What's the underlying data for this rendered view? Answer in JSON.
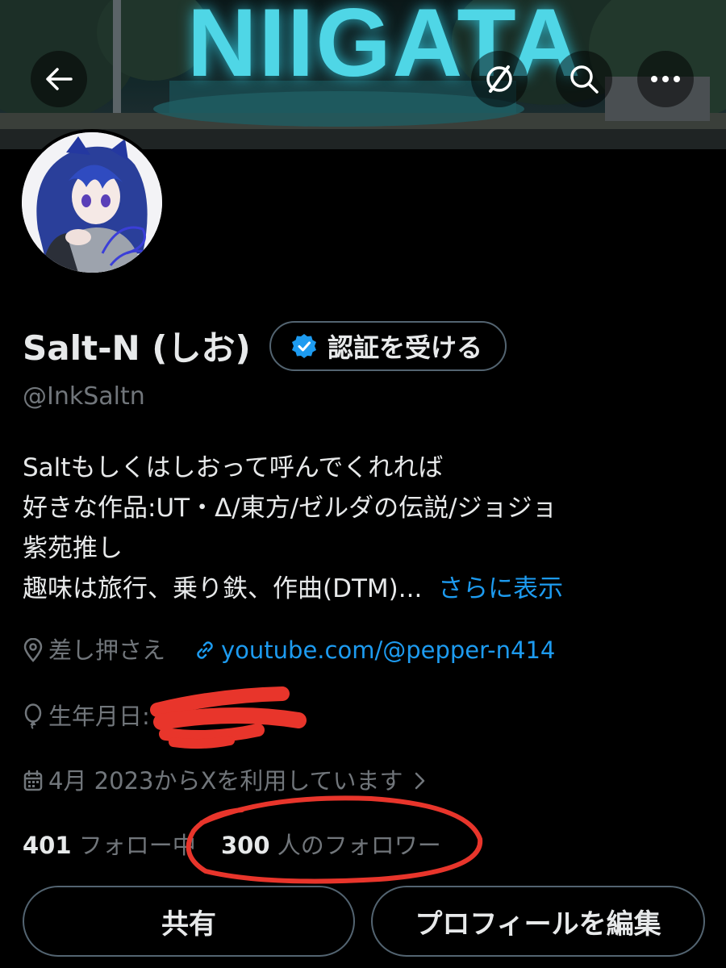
{
  "header": {
    "banner_sign_text": "NIIGATA",
    "back_icon": "arrow-left-icon",
    "grok_icon": "grok-slash-circle-icon",
    "search_icon": "search-icon",
    "more_icon": "more-horizontal-icon"
  },
  "profile": {
    "display_name": "Salt-N (しお)",
    "verify_button_label": "認証を受ける",
    "handle": "@InkSaltn",
    "bio_lines": [
      "Saltもしくはしおって呼んでくれれば",
      "好きな作品:UT・Δ/東方/ゼルダの伝説/ジョジョ",
      "紫苑推し",
      "趣味は旅行、乗り鉄、作曲(DTM)..."
    ],
    "show_more_label": "さらに表示",
    "location": "差し押さえ",
    "website": "youtube.com/@pepper-n414",
    "birthday_label": "生年月日:",
    "joined": "4月 2023からXを利用しています",
    "following_count": "401",
    "following_label": "フォロー中",
    "followers_count": "300",
    "followers_label": "人のフォロワー"
  },
  "actions": {
    "share_label": "共有",
    "edit_profile_label": "プロフィールを編集"
  },
  "colors": {
    "background": "#000000",
    "primary_text": "#e7e9ea",
    "secondary_text": "#71767b",
    "link": "#1d9bf0",
    "border": "#536471",
    "annotation_red": "#e8352b"
  }
}
